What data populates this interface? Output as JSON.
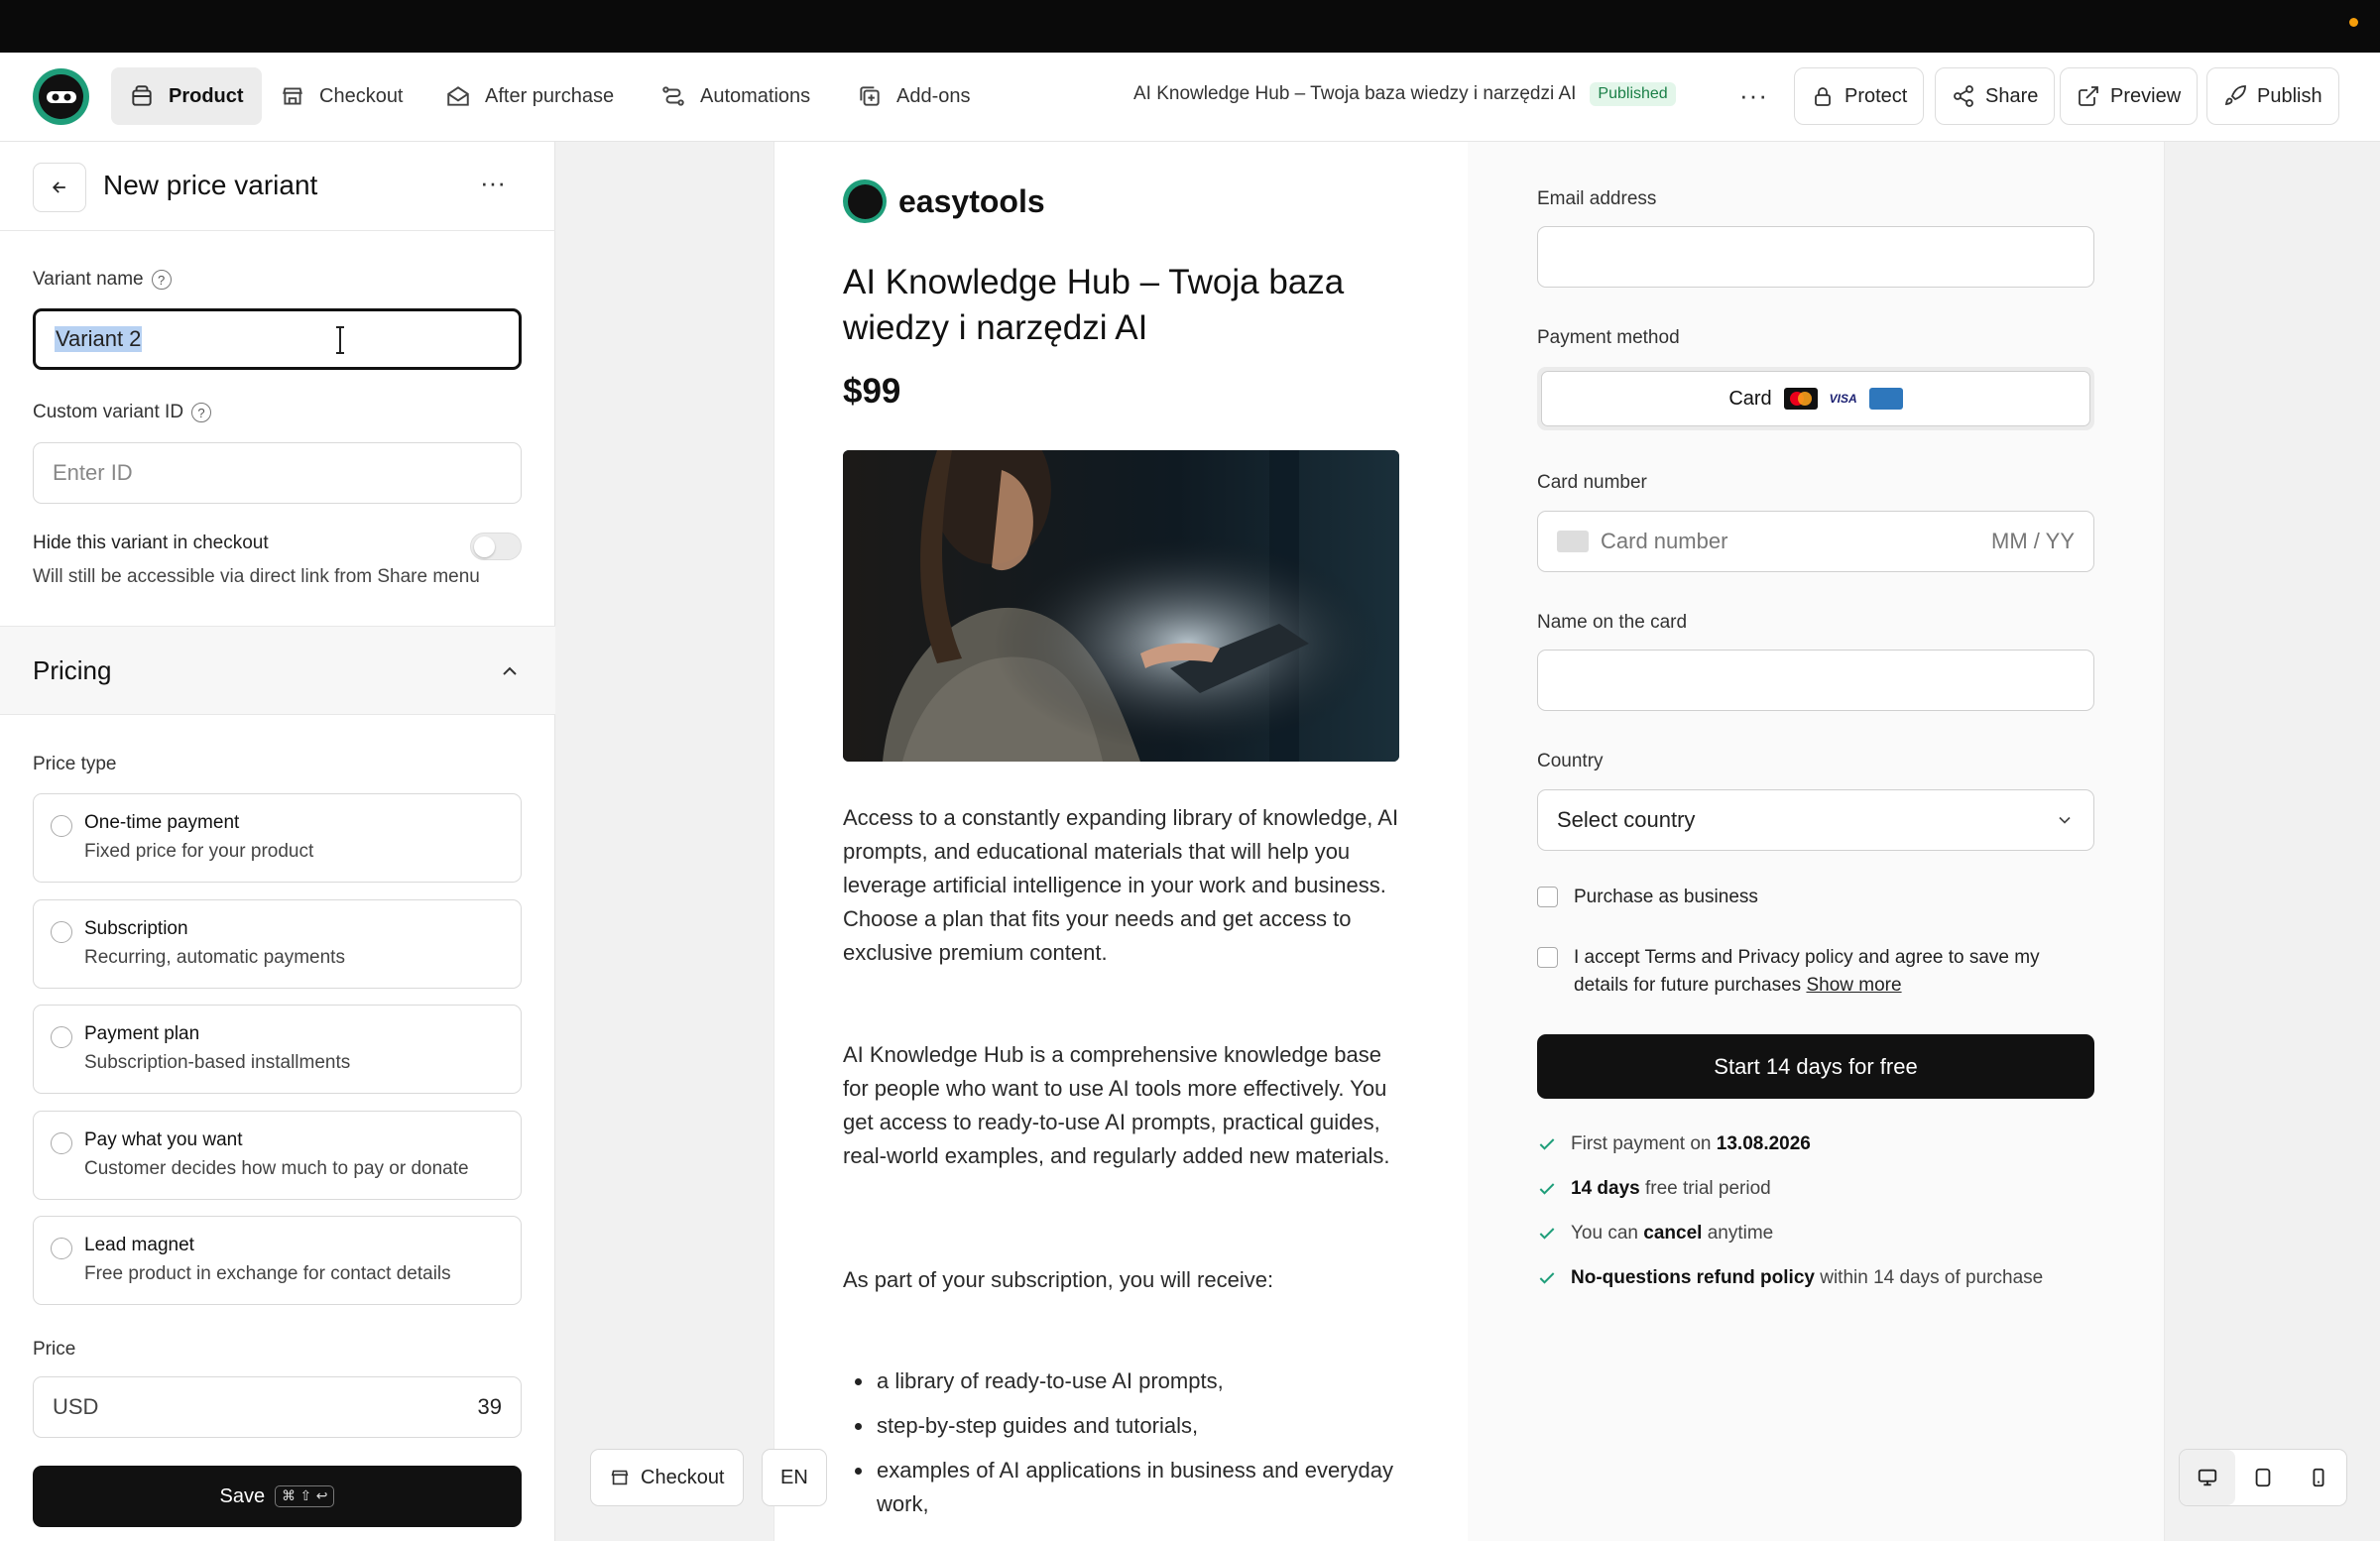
{
  "header": {
    "tabs": [
      {
        "label": "Product",
        "icon": "box-icon",
        "active": true
      },
      {
        "label": "Checkout",
        "icon": "store-icon"
      },
      {
        "label": "After purchase",
        "icon": "mail-open-icon"
      },
      {
        "label": "Automations",
        "icon": "workflow-icon"
      },
      {
        "label": "Add-ons",
        "icon": "plus-square-icon"
      }
    ],
    "product_title": "AI Knowledge Hub – Twoja baza wiedzy i narzędzi AI",
    "status_badge": "Published",
    "more": "···",
    "buttons": {
      "protect": "Protect",
      "share": "Share",
      "preview": "Preview",
      "publish": "Publish"
    }
  },
  "sidebar": {
    "title": "New price variant",
    "more": "···",
    "variant_name": {
      "label": "Variant name",
      "value": "Variant 2"
    },
    "custom_id": {
      "label": "Custom variant ID",
      "placeholder": "Enter ID"
    },
    "hide_toggle": {
      "label": "Hide this variant in checkout",
      "sub": "Will still be accessible via direct link from Share menu",
      "enabled": false
    },
    "pricing_section": "Pricing",
    "price_type_label": "Price type",
    "price_types": [
      {
        "title": "One-time payment",
        "sub": "Fixed price for your product"
      },
      {
        "title": "Subscription",
        "sub": "Recurring, automatic payments"
      },
      {
        "title": "Payment plan",
        "sub": "Subscription-based installments"
      },
      {
        "title": "Pay what you want",
        "sub": "Customer decides how much to pay or donate"
      },
      {
        "title": "Lead magnet",
        "sub": "Free product in exchange for contact details"
      }
    ],
    "price": {
      "label": "Price",
      "currency": "USD",
      "value": "39"
    },
    "save": {
      "label": "Save",
      "shortcut": "⌘ ⇧ ↩"
    }
  },
  "preview": {
    "brand": "easytools",
    "product_title": "AI Knowledge Hub – Twoja baza wiedzy i narzędzi AI",
    "price": "$99",
    "description": [
      "Access to a constantly expanding library of knowledge, AI prompts, and educational materials that will help you leverage artificial intelligence in your work and business. Choose a plan that fits your needs and get access to exclusive premium content.",
      "AI Knowledge Hub is a comprehensive knowledge base for people who want to use AI tools more effectively. You get access to ready-to-use AI prompts, practical guides, real-world examples, and regularly added new materials.",
      "As part of your subscription, you will receive:"
    ],
    "bullets": [
      "a library of ready-to-use AI prompts,",
      "step-by-step guides and tutorials,",
      "examples of AI applications in business and everyday work,"
    ],
    "form": {
      "email_label": "Email address",
      "payment_label": "Payment method",
      "payment_value": "Card",
      "card_label": "Card number",
      "card_placeholder": "Card number",
      "expiry_placeholder": "MM / YY",
      "name_label": "Name on the card",
      "country_label": "Country",
      "country_placeholder": "Select country",
      "business_label": "Purchase as business",
      "terms_label": "I accept Terms and Privacy policy and agree to save my details for future purchases",
      "terms_link": "Show more",
      "cta": "Start 14 days for free"
    },
    "benefits": [
      {
        "pre": "First payment on ",
        "bold": "13.08.2026",
        "post": ""
      },
      {
        "pre": "",
        "bold": "14 days",
        "post": " free trial period"
      },
      {
        "pre": "You can ",
        "bold": "cancel",
        "post": " anytime"
      },
      {
        "pre": "",
        "bold": "No-questions refund policy",
        "post": " within 14 days of purchase"
      }
    ]
  },
  "floating": {
    "checkout": "Checkout",
    "language": "EN"
  },
  "colors": {
    "accent": "#1f9e7a",
    "dark": "#111111",
    "published": "#1a7f47"
  }
}
